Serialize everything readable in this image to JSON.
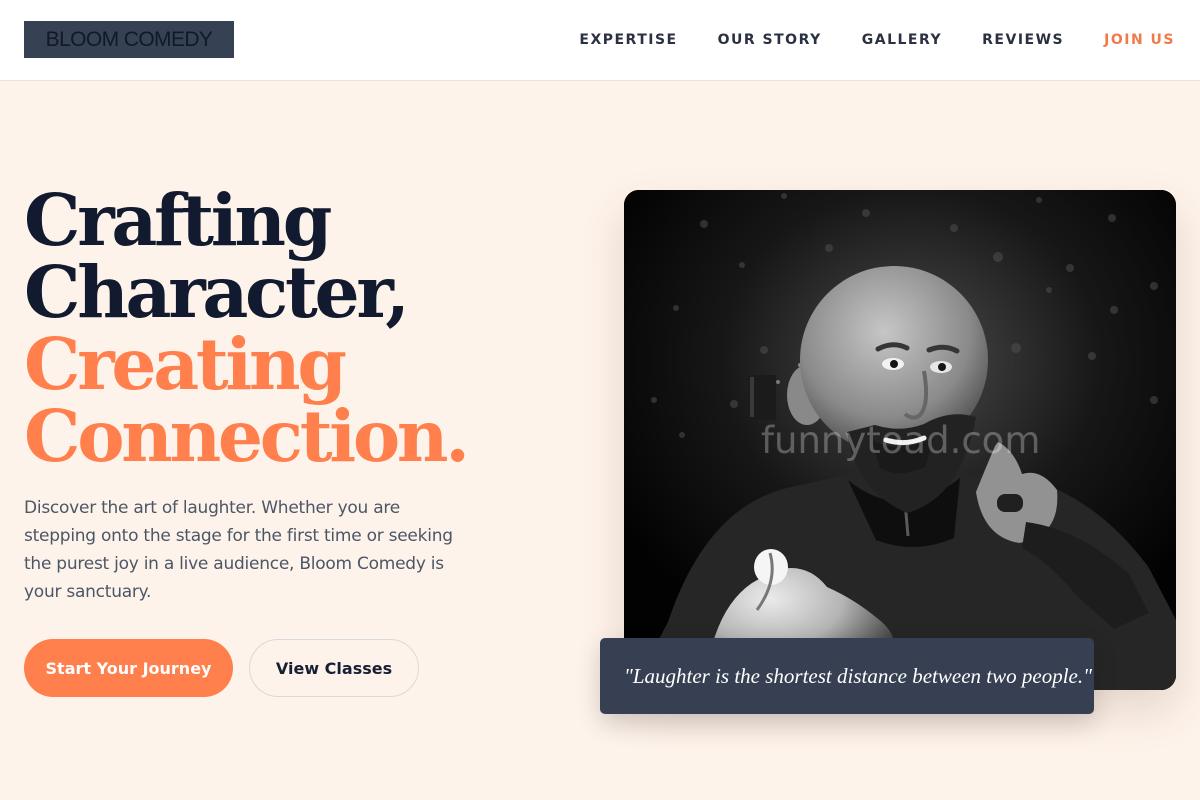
{
  "header": {
    "logo": "BLOOM COMEDY",
    "nav": [
      {
        "label": "EXPERTISE"
      },
      {
        "label": "OUR STORY"
      },
      {
        "label": "GALLERY"
      },
      {
        "label": "REVIEWS"
      },
      {
        "label": "JOIN US",
        "accent": true
      }
    ]
  },
  "hero": {
    "title_lines": [
      "Crafting",
      "Character,",
      "Creating",
      "Connection."
    ],
    "description": "Discover the art of laughter. Whether you are stepping onto the stage for the first time or seeking the purest joy in a live audience, Bloom Comedy is your sanctuary.",
    "primary_button": "Start Your Journey",
    "secondary_button": "View Classes"
  },
  "image": {
    "watermark": "funnytoad.com",
    "quote": "\"Laughter is the shortest distance between two people.\""
  },
  "colors": {
    "background": "#fef3ea",
    "accent": "#ff7f4d",
    "dark": "#111a2e",
    "quote_panel": "#373f52"
  }
}
